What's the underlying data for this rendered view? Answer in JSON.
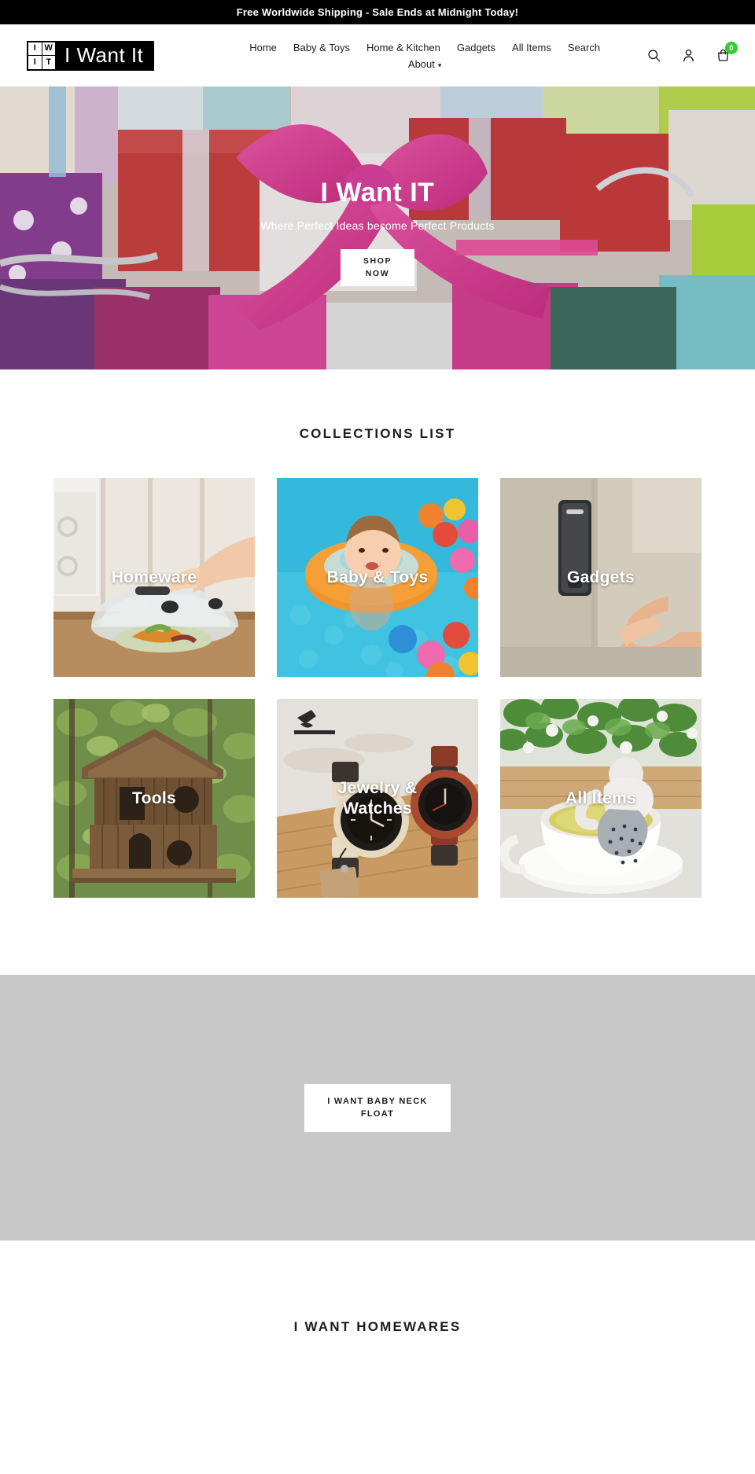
{
  "announcement": {
    "text": "Free Worldwide Shipping - Sale Ends at Midnight Today!"
  },
  "header": {
    "logo": {
      "mark_cells": [
        "I",
        "W",
        "I",
        "T"
      ],
      "wordmark": "I Want It"
    },
    "nav": {
      "row1": [
        {
          "label": "Home"
        },
        {
          "label": "Baby & Toys"
        },
        {
          "label": "Home & Kitchen"
        },
        {
          "label": "Gadgets"
        },
        {
          "label": "All Items"
        },
        {
          "label": "Search"
        }
      ],
      "row2": [
        {
          "label": "About",
          "has_dropdown": true,
          "caret": "⌄"
        }
      ]
    },
    "icons": {
      "search": "search-icon",
      "account": "account-icon",
      "cart": "cart-icon",
      "cart_count": "0",
      "cart_badge_color": "#32cd32"
    }
  },
  "hero": {
    "title": "I Want IT",
    "subtitle": "Where Perfect Ideas become Perfect Products",
    "button_line1": "SHOP",
    "button_line2": "NOW"
  },
  "collections": {
    "title": "COLLECTIONS LIST",
    "items": [
      {
        "label": "Homeware"
      },
      {
        "label": "Baby & Toys"
      },
      {
        "label": "Gadgets"
      },
      {
        "label": "Tools"
      },
      {
        "label": "Jewelry &\nWatches"
      },
      {
        "label": "All Items"
      }
    ]
  },
  "feature_band": {
    "button_line1": "I WANT BABY NECK",
    "button_line2": "FLOAT"
  },
  "homewares": {
    "title": "I WANT HOMEWARES"
  }
}
